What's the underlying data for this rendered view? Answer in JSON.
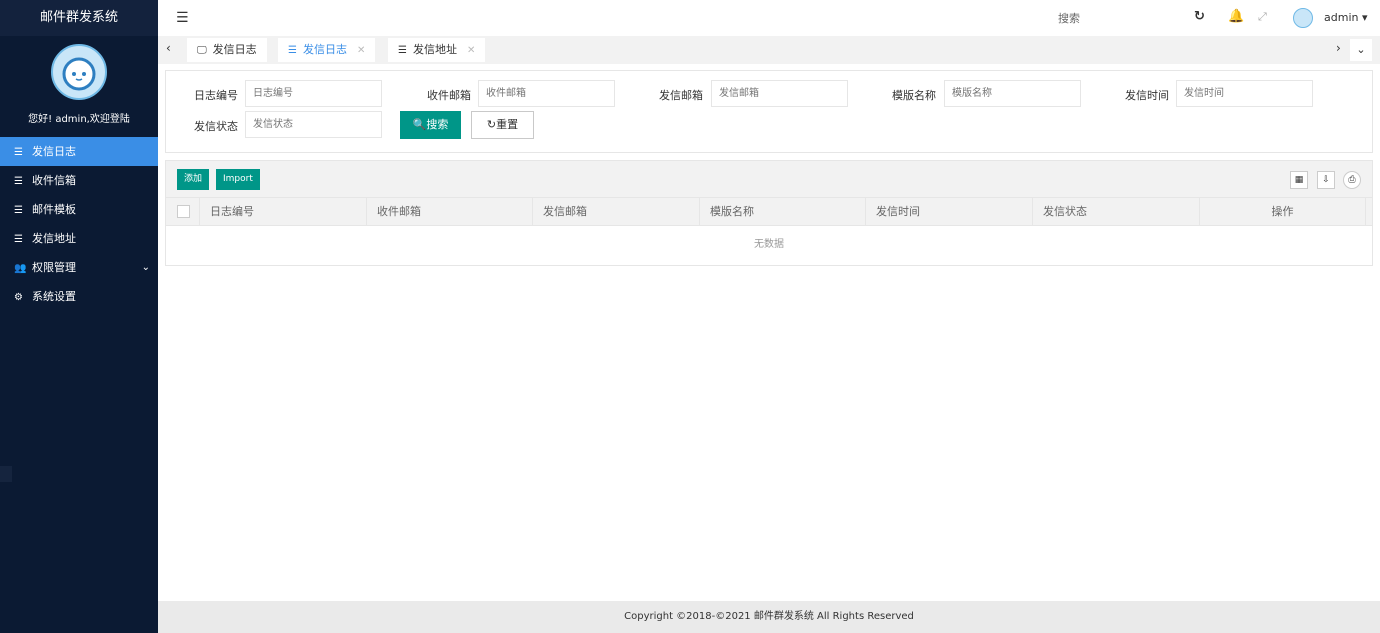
{
  "app": {
    "title": "邮件群发系统",
    "welcome": "您好! admin,欢迎登陆"
  },
  "sidebar": {
    "items": [
      {
        "label": "发信日志",
        "icon": "list-icon",
        "active": true
      },
      {
        "label": "收件信箱",
        "icon": "list-icon"
      },
      {
        "label": "邮件模板",
        "icon": "list-icon"
      },
      {
        "label": "发信地址",
        "icon": "list-icon"
      },
      {
        "label": "权限管理",
        "icon": "users-icon",
        "expandable": true
      },
      {
        "label": "系统设置",
        "icon": "gear-icon"
      }
    ]
  },
  "header": {
    "search": "搜索",
    "user": "admin"
  },
  "tabs": [
    {
      "label": "发信日志",
      "icon": "monitor-icon",
      "closable": false
    },
    {
      "label": "发信日志",
      "icon": "list-icon",
      "closable": true,
      "active": true
    },
    {
      "label": "发信地址",
      "icon": "list-icon",
      "closable": true
    }
  ],
  "search": {
    "fields": [
      {
        "label": "日志编号",
        "placeholder": "日志编号"
      },
      {
        "label": "收件邮箱",
        "placeholder": "收件邮箱"
      },
      {
        "label": "发信邮箱",
        "placeholder": "发信邮箱"
      },
      {
        "label": "模版名称",
        "placeholder": "模版名称"
      },
      {
        "label": "发信时间",
        "placeholder": "发信时间"
      },
      {
        "label": "发信状态",
        "placeholder": "发信状态"
      }
    ],
    "search_label": "搜索",
    "reset_label": "重置"
  },
  "table": {
    "add_label": "添加",
    "import_label": "Import",
    "columns": [
      "日志编号",
      "收件邮箱",
      "发信邮箱",
      "模版名称",
      "发信时间",
      "发信状态",
      "操作"
    ],
    "empty": "无数据"
  },
  "footer": {
    "text": "Copyright ©2018-©2021 邮件群发系统 All Rights Reserved"
  },
  "colors": {
    "sidebar_bg": "#0b1a33",
    "active": "#3a8ee6",
    "primary_btn": "#009688"
  }
}
